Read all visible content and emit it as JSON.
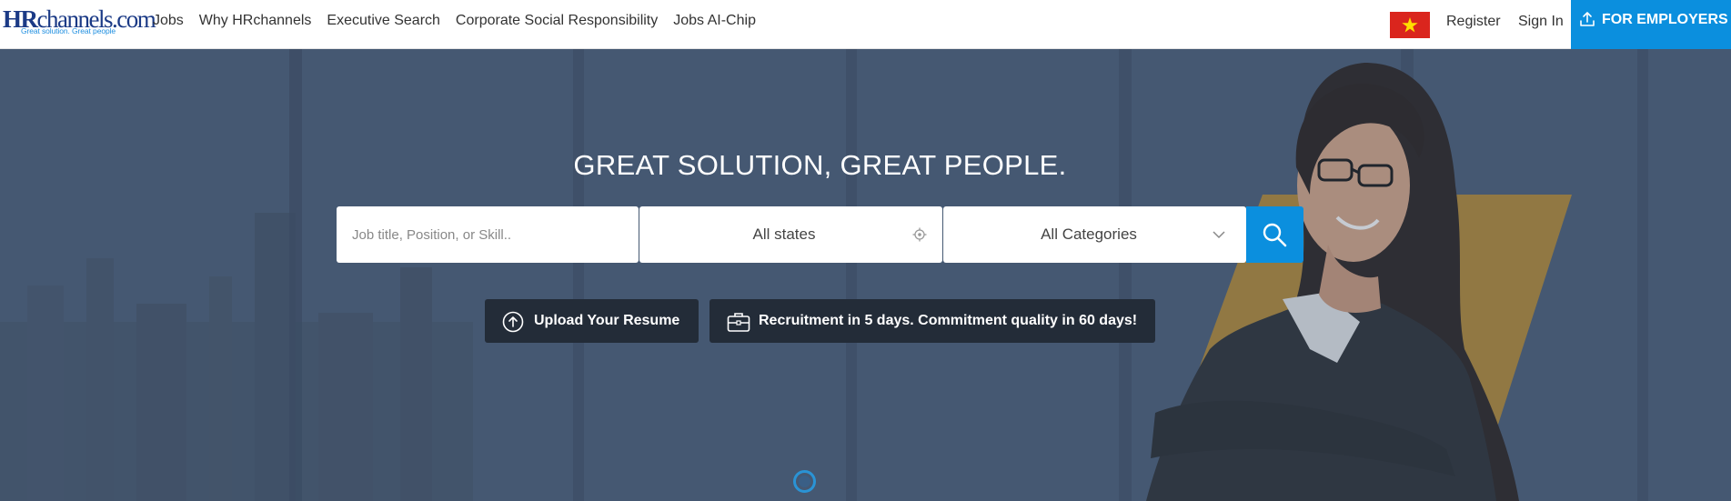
{
  "header": {
    "logo": {
      "main_hr": "HR",
      "main_rest": "channels.com",
      "tagline": "Great solution. Great people"
    },
    "nav": [
      {
        "label": "Jobs"
      },
      {
        "label": "Why HRchannels"
      },
      {
        "label": "Executive Search"
      },
      {
        "label": "Corporate Social Responsibility"
      },
      {
        "label": "Jobs AI-Chip"
      }
    ],
    "language_flag": "vietnam-flag-icon",
    "register_label": "Register",
    "signin_label": "Sign In",
    "employers_label": "FOR EMPLOYERS"
  },
  "hero": {
    "title": "GREAT SOLUTION, GREAT PEOPLE.",
    "search": {
      "job_placeholder": "Job title, Position, or Skill..",
      "job_value": "",
      "state_value": "All states",
      "category_value": "All Categories"
    },
    "upload_label": "Upload Your Resume",
    "recruit_label": "Recruitment in 5 days. Commitment quality in 60 days!"
  },
  "colors": {
    "accent": "#0b8fde",
    "hero_overlay": "#4b5d77",
    "pill_bg": "#232c38",
    "accent_gold": "#c9952f",
    "flag_red": "#da251d",
    "flag_star": "#ffde00",
    "logo_blue": "#1b3a86"
  }
}
